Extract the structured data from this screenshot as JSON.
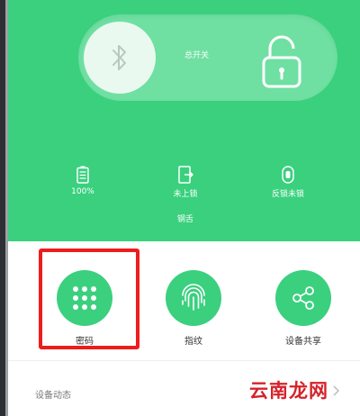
{
  "header": {
    "switch_label": "总开关"
  },
  "status": {
    "battery": "100%",
    "lock_state": "未上锁",
    "anti_lock": "反锁未锁",
    "sub_label": "钢舌"
  },
  "actions": [
    {
      "label": "密码",
      "icon": "keypad-icon"
    },
    {
      "label": "指纹",
      "icon": "fingerprint-icon"
    },
    {
      "label": "设备共享",
      "icon": "share-icon"
    }
  ],
  "section": {
    "title": "设备动态"
  },
  "watermark": "云南龙网",
  "colors": {
    "accent": "#3ad07e",
    "highlight": "#ee1c1c"
  }
}
